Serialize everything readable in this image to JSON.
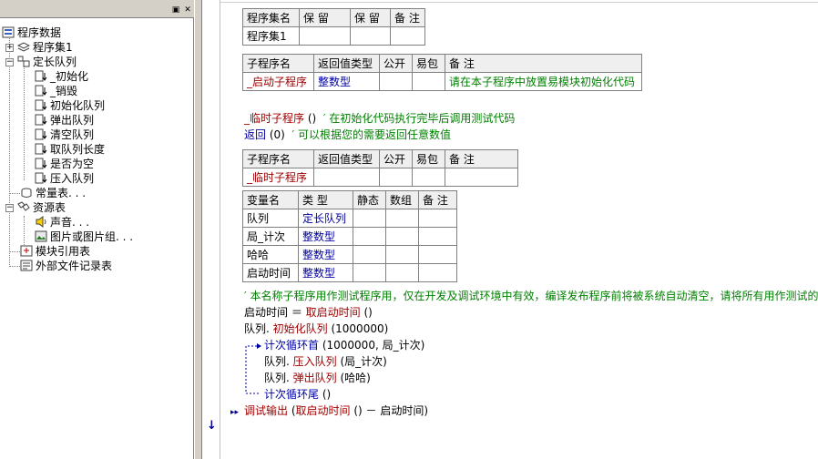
{
  "left_pane": {
    "header_buttons": {
      "pin": "▣",
      "close": "✕"
    },
    "tree": {
      "root": "程序数据",
      "program_set": "程序集1",
      "class": "定长队列",
      "methods": [
        "_初始化",
        "_销毁",
        "初始化队列",
        "弹出队列",
        "清空队列",
        "取队列长度",
        "是否为空",
        "压入队列"
      ],
      "constants": "常量表. . .",
      "resources": "资源表",
      "sound": "声音. . .",
      "images": "图片或图片组. . .",
      "module_refs": "模块引用表",
      "external_files": "外部文件记录表"
    }
  },
  "program_set_table": {
    "headers": [
      "程序集名",
      "保 留",
      "保 留",
      "备 注"
    ],
    "row": [
      "程序集1",
      "",
      "",
      ""
    ]
  },
  "startup_sub_table": {
    "headers": [
      "子程序名",
      "返回值类型",
      "公开",
      "易包",
      "备 注"
    ],
    "row": [
      "_启动子程序",
      "整数型",
      "",
      "",
      "请在本子程序中放置易模块初始化代码"
    ]
  },
  "code_lines": {
    "temp_sub_decl_name": "_临时子程序",
    "temp_sub_decl_paren": " ()",
    "temp_sub_decl_comment": "′ 在初始化代码执行完毕后调用测试代码",
    "return_kw": "返回",
    "return_args": " (0)",
    "return_comment": "′ 可以根据您的需要返回任意数值"
  },
  "temp_sub_table": {
    "headers": [
      "子程序名",
      "返回值类型",
      "公开",
      "易包",
      "备 注"
    ],
    "row": [
      "_临时子程序",
      "",
      "",
      "",
      ""
    ]
  },
  "var_table": {
    "headers": [
      "变量名",
      "类 型",
      "静态",
      "数组",
      "备 注"
    ],
    "rows": [
      [
        "队列",
        "定长队列",
        "",
        "",
        ""
      ],
      [
        "局_计次",
        "整数型",
        "",
        "",
        ""
      ],
      [
        "哈哈",
        "整数型",
        "",
        "",
        ""
      ],
      [
        "启动时间",
        "整数型",
        "",
        "",
        ""
      ]
    ]
  },
  "body_lines": {
    "comment": "′ 本名称子程序用作测试程序用，仅在开发及调试环境中有效，编译发布程序前将被系统自动清空，请将所有用作测试的",
    "l1_var": "启动时间",
    "l1_op": " ＝ ",
    "l1_fn": "取启动时间",
    "l1_args": " ()",
    "l2_obj": "队列.",
    "l2_fn": " 初始化队列",
    "l2_args": " (1000000)",
    "loop_head": "计次循环首",
    "loop_head_args": " (1000000, 局_计次)",
    "in1_obj": "队列.",
    "in1_fn": " 压入队列",
    "in1_args": " (局_计次)",
    "in2_obj": "队列.",
    "in2_fn": " 弹出队列",
    "in2_args": " (哈哈)",
    "loop_tail": "计次循环尾",
    "loop_tail_args": " ()",
    "debug_fn": "调试输出",
    "debug_args_open": " (",
    "debug_inner_fn": "取启动时间",
    "debug_args_rest": " () － 启动时间)",
    "cursor_marker": "↓",
    "arrow_marker": "▸▸"
  }
}
